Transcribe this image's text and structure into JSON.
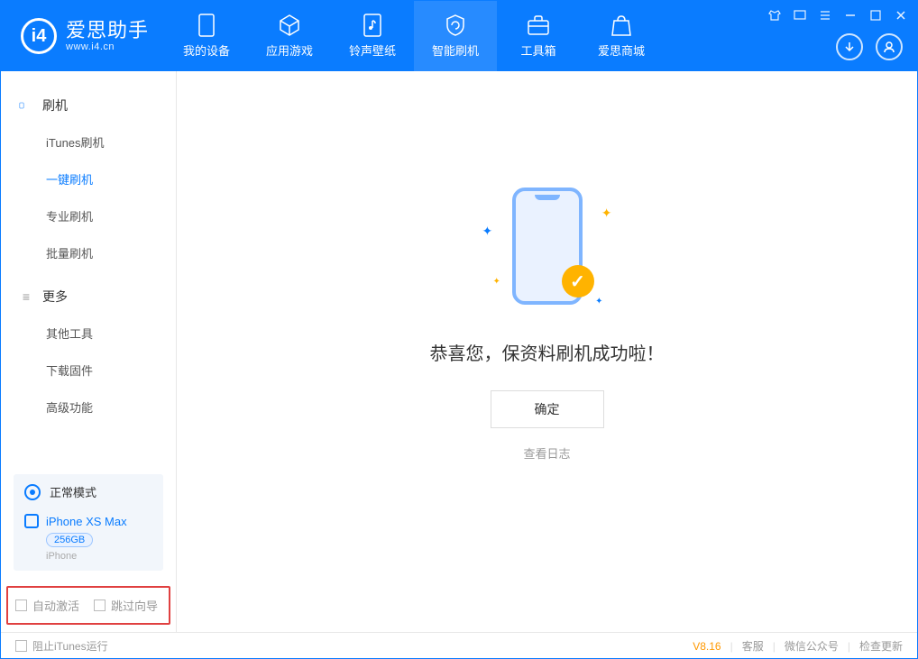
{
  "app": {
    "title": "爱思助手",
    "domain": "www.i4.cn"
  },
  "nav": {
    "items": [
      {
        "label": "我的设备"
      },
      {
        "label": "应用游戏"
      },
      {
        "label": "铃声壁纸"
      },
      {
        "label": "智能刷机"
      },
      {
        "label": "工具箱"
      },
      {
        "label": "爱思商城"
      }
    ]
  },
  "sidebar": {
    "group1": {
      "title": "刷机",
      "items": [
        {
          "label": "iTunes刷机"
        },
        {
          "label": "一键刷机"
        },
        {
          "label": "专业刷机"
        },
        {
          "label": "批量刷机"
        }
      ]
    },
    "group2": {
      "title": "更多",
      "items": [
        {
          "label": "其他工具"
        },
        {
          "label": "下载固件"
        },
        {
          "label": "高级功能"
        }
      ]
    },
    "mode": {
      "label": "正常模式"
    },
    "device": {
      "name": "iPhone XS Max",
      "capacity": "256GB",
      "type": "iPhone"
    },
    "options": {
      "auto_activate": "自动激活",
      "skip_guide": "跳过向导"
    }
  },
  "main": {
    "success_message": "恭喜您，保资料刷机成功啦！",
    "ok_button": "确定",
    "view_log": "查看日志"
  },
  "footer": {
    "block_itunes": "阻止iTunes运行",
    "version": "V8.16",
    "links": {
      "customer_service": "客服",
      "wechat": "微信公众号",
      "check_update": "检查更新"
    }
  }
}
